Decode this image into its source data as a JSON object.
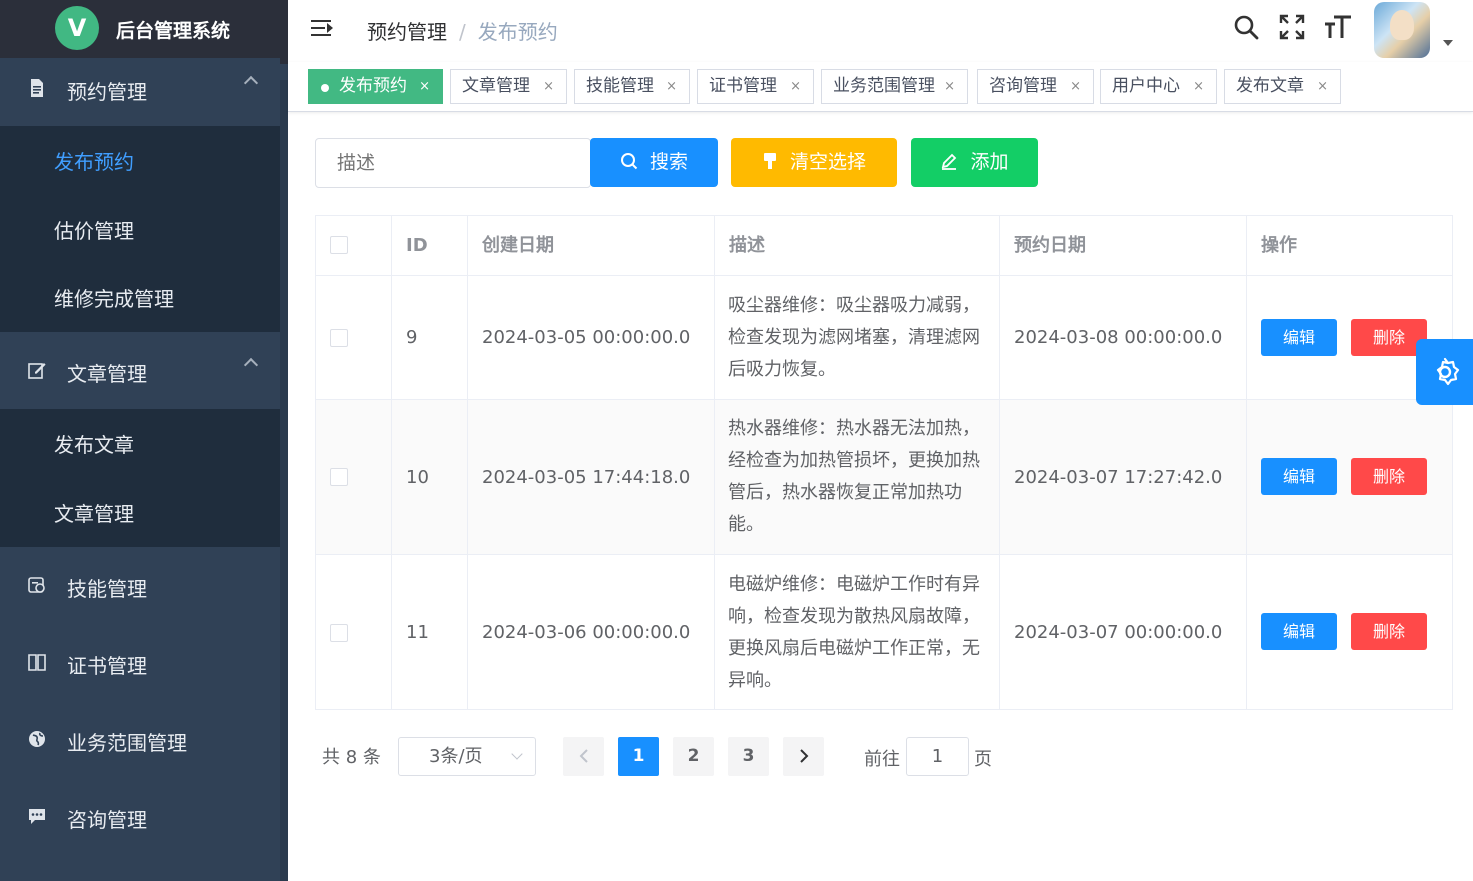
{
  "app": {
    "logo_letter": "V",
    "title": "后台管理系统"
  },
  "sidebar": {
    "groups": [
      {
        "label": "预约管理",
        "icon": "document-icon",
        "expanded": true,
        "children": [
          {
            "label": "发布预约",
            "active": true
          },
          {
            "label": "估价管理"
          },
          {
            "label": "维修完成管理"
          }
        ]
      },
      {
        "label": "文章管理",
        "icon": "edit-icon",
        "expanded": true,
        "children": [
          {
            "label": "发布文章"
          },
          {
            "label": "文章管理"
          }
        ]
      },
      {
        "label": "技能管理",
        "icon": "skill-icon"
      },
      {
        "label": "证书管理",
        "icon": "book-icon"
      },
      {
        "label": "业务范围管理",
        "icon": "globe-icon"
      },
      {
        "label": "咨询管理",
        "icon": "chat-icon"
      }
    ]
  },
  "header": {
    "breadcrumb": [
      "预约管理",
      "发布预约"
    ],
    "breadcrumb_separator": "/",
    "icons": [
      "search-icon",
      "fullscreen-icon",
      "font-size-icon"
    ]
  },
  "tags": [
    {
      "label": "发布预约",
      "active": true
    },
    {
      "label": "文章管理"
    },
    {
      "label": "技能管理"
    },
    {
      "label": "证书管理"
    },
    {
      "label": "业务范围管理"
    },
    {
      "label": "咨询管理"
    },
    {
      "label": "用户中心"
    },
    {
      "label": "发布文章"
    }
  ],
  "tag_close": "×",
  "toolbar": {
    "search_placeholder": "描述",
    "search_label": "搜索",
    "clear_label": "清空选择",
    "add_label": "添加"
  },
  "table": {
    "columns": [
      "ID",
      "创建日期",
      "描述",
      "预约日期",
      "操作"
    ],
    "rows": [
      {
        "id": "9",
        "created": "2024-03-05 00:00:00.0",
        "desc": "吸尘器维修：吸尘器吸力减弱，检查发现为滤网堵塞，清理滤网后吸力恢复。",
        "booked": "2024-03-08 00:00:00.0"
      },
      {
        "id": "10",
        "created": "2024-03-05 17:44:18.0",
        "desc": "热水器维修：热水器无法加热，经检查为加热管损坏，更换加热管后，热水器恢复正常加热功能。",
        "booked": "2024-03-07 17:27:42.0"
      },
      {
        "id": "11",
        "created": "2024-03-06 00:00:00.0",
        "desc": "电磁炉维修：电磁炉工作时有异响，检查发现为散热风扇故障，更换风扇后电磁炉工作正常，无异响。",
        "booked": "2024-03-07 00:00:00.0"
      }
    ],
    "edit_label": "编辑",
    "delete_label": "删除"
  },
  "pagination": {
    "total_text": "共 8 条",
    "page_size": "3条/页",
    "pages": [
      "1",
      "2",
      "3"
    ],
    "current_page": "1",
    "goto_prefix": "前往",
    "goto_value": "1",
    "goto_suffix": "页"
  },
  "colors": {
    "sidebar_bg": "#304156",
    "submenu_bg": "#1f2d3d",
    "active_text": "#409eff",
    "tag_active": "#42b983",
    "primary": "#1890ff",
    "warning": "#ffba00",
    "success": "#13ce66",
    "danger": "#ff4949"
  }
}
